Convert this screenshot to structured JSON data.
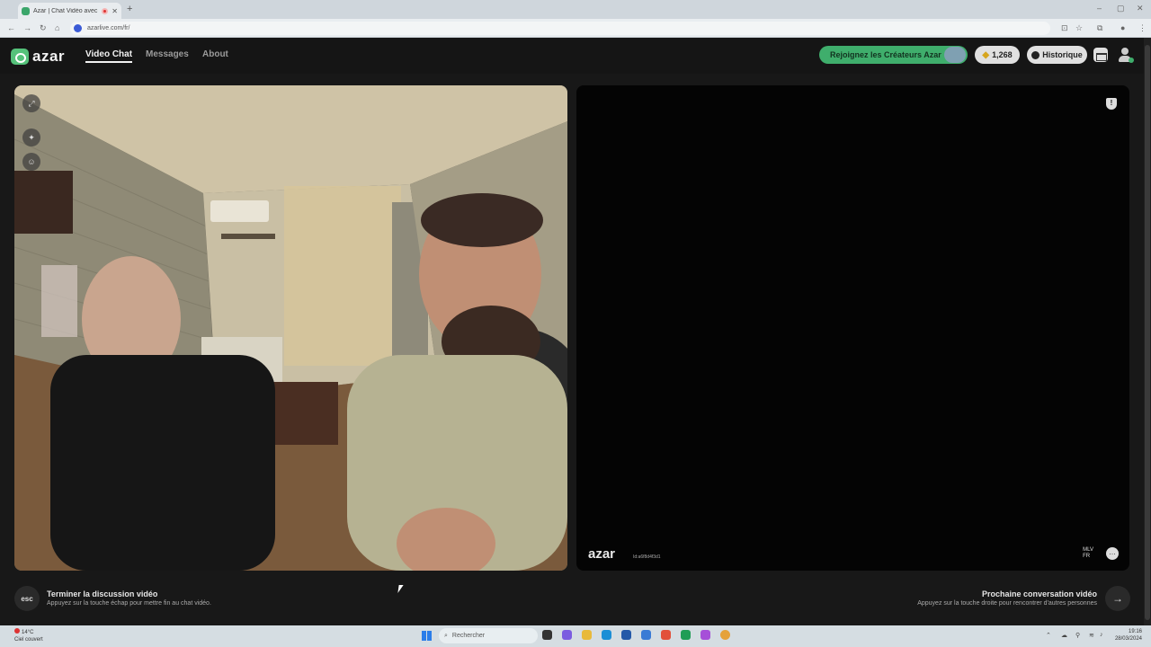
{
  "browser": {
    "tab_title": "Azar | Chat Vidéo avec de ...",
    "tab_close": "✕",
    "new_tab": "+",
    "url": "azarlive.com/fr/",
    "window_controls": [
      "–",
      "▢",
      "✕"
    ]
  },
  "header": {
    "logo": "azar",
    "nav": [
      {
        "label": "Video Chat",
        "active": true
      },
      {
        "label": "Messages",
        "active": false
      },
      {
        "label": "About",
        "active": false
      }
    ],
    "creators_label": "Rejoignez les Créateurs Azar",
    "coins": "1,268",
    "history_label": "Historique"
  },
  "left_pane": {
    "tools": [
      "expand-icon",
      "magic-wand-icon",
      "face-filter-icon"
    ]
  },
  "right_pane": {
    "watermark": "azar",
    "watermark_id": "Id:a6f8d4f3d1",
    "partner_name": "MLV",
    "partner_country": "FR"
  },
  "footer": {
    "esc_label": "esc",
    "end_title": "Terminer la discussion vidéo",
    "end_desc": "Appuyez sur la touche échap pour mettre fin au chat vidéo.",
    "next_title": "Prochaine conversation vidéo",
    "next_desc": "Appuyez sur la touche droite pour rencontrer d'autres personnes",
    "next_arrow": "→"
  },
  "taskbar": {
    "weather_temp": "14°C",
    "weather_desc": "Ciel couvert",
    "search_placeholder": "Rechercher",
    "time": "19:16",
    "date": "28/03/2024"
  },
  "colors": {
    "brand_green": "#3fae6c",
    "background": "#181818"
  }
}
